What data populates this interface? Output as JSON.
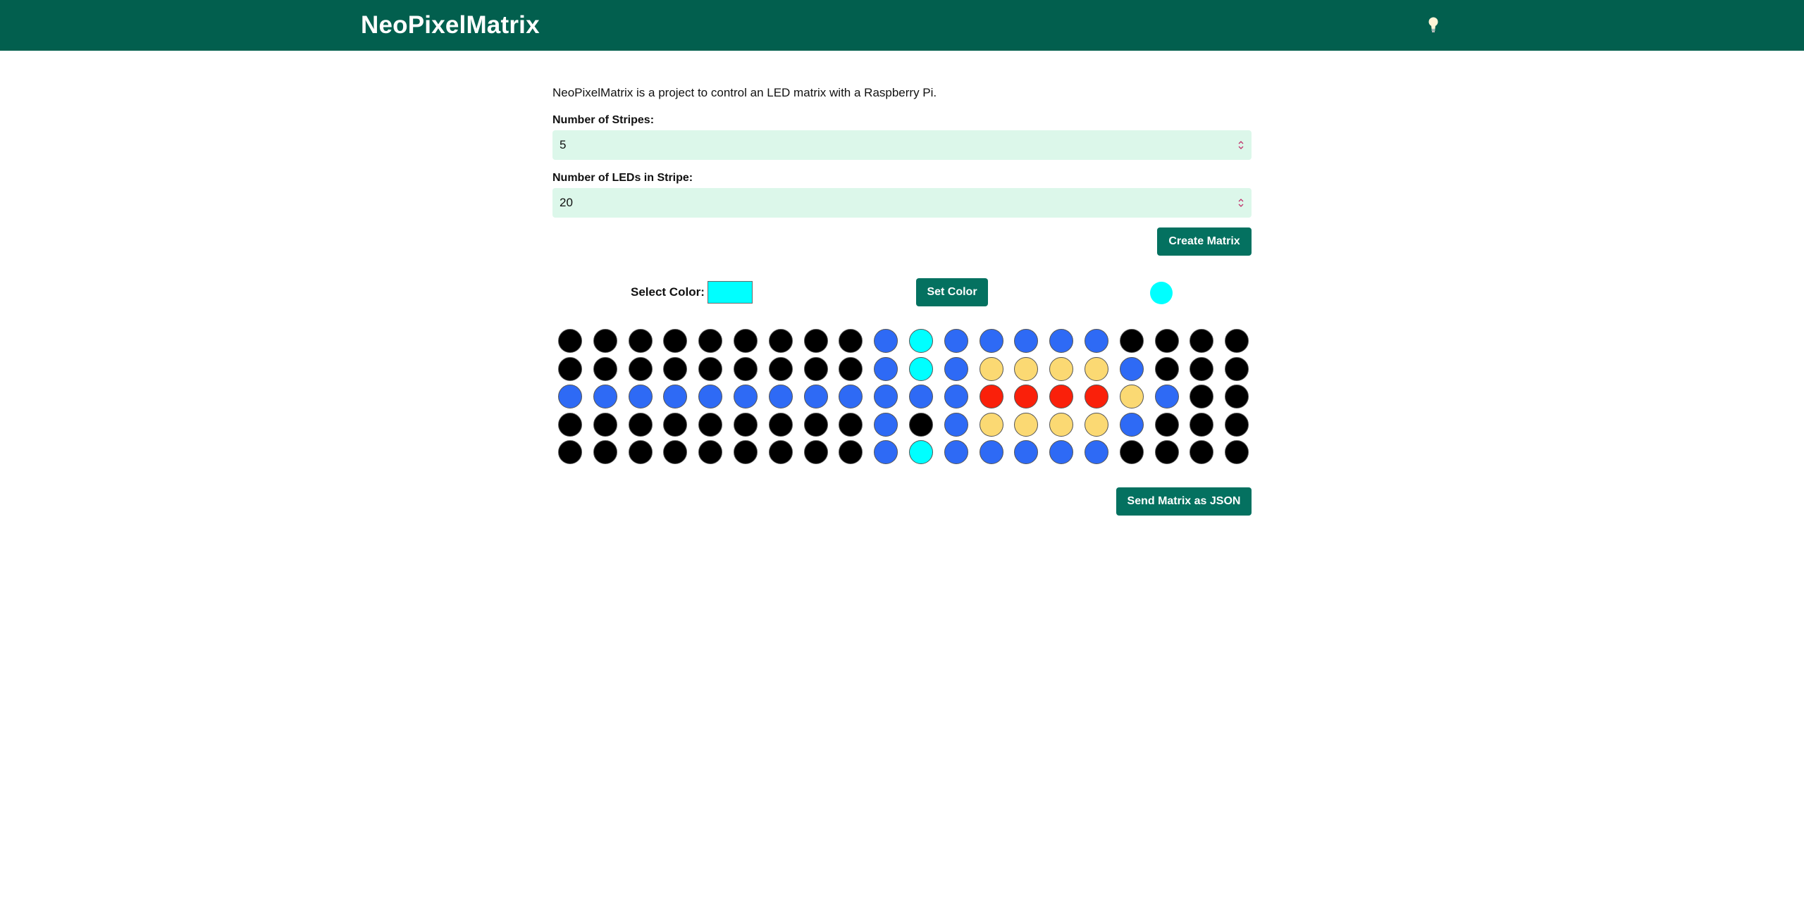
{
  "header": {
    "brand": "NeoPixelMatrix",
    "bulb_icon": "lightbulb-icon"
  },
  "intro": "NeoPixelMatrix is a project to control an LED matrix with a Raspberry Pi.",
  "stripes": {
    "label": "Number of Stripes:",
    "value": "5"
  },
  "leds": {
    "label": "Number of LEDs in Stripe:",
    "value": "20"
  },
  "create_button": "Create Matrix",
  "color_picker": {
    "label": "Select Color:",
    "value": "#00ffff"
  },
  "set_color_button": "Set Color",
  "preview_color": "#00ffff",
  "send_button": "Send Matrix as JSON",
  "palette": {
    "K": "#000000",
    "B": "#2e6af5",
    "C": "#00ffff",
    "Y": "#fbd973",
    "R": "#fa200a"
  },
  "colors": {
    "header_bg": "#025f4e",
    "button_bg": "#047160",
    "input_bg": "#dcf7ea"
  },
  "matrix": [
    [
      "K",
      "K",
      "K",
      "K",
      "K",
      "K",
      "K",
      "K",
      "K",
      "B",
      "C",
      "B",
      "B",
      "B",
      "B",
      "B",
      "K",
      "K",
      "K",
      "K"
    ],
    [
      "K",
      "K",
      "K",
      "K",
      "K",
      "K",
      "K",
      "K",
      "K",
      "B",
      "C",
      "B",
      "Y",
      "Y",
      "Y",
      "Y",
      "B",
      "K",
      "K",
      "K"
    ],
    [
      "B",
      "B",
      "B",
      "B",
      "B",
      "B",
      "B",
      "B",
      "B",
      "B",
      "B",
      "B",
      "R",
      "R",
      "R",
      "R",
      "Y",
      "B",
      "K",
      "K"
    ],
    [
      "K",
      "K",
      "K",
      "K",
      "K",
      "K",
      "K",
      "K",
      "K",
      "B",
      "K",
      "B",
      "Y",
      "Y",
      "Y",
      "Y",
      "B",
      "K",
      "K",
      "K"
    ],
    [
      "K",
      "K",
      "K",
      "K",
      "K",
      "K",
      "K",
      "K",
      "K",
      "B",
      "C",
      "B",
      "B",
      "B",
      "B",
      "B",
      "K",
      "K",
      "K",
      "K"
    ]
  ]
}
